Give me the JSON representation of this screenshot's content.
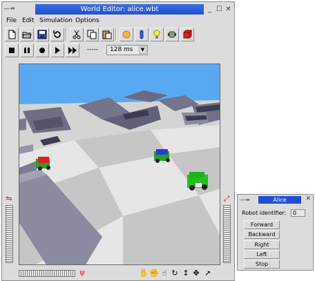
{
  "main_window": {
    "title": "World Editor: alice.wbt",
    "controls": {
      "left": "—⇸",
      "minimize": "_",
      "maximize": "☐",
      "close": "✕"
    },
    "menu": [
      "File",
      "Edit",
      "Simulation",
      "Options"
    ]
  },
  "simulation": {
    "time_readout": "-----",
    "speed_value": "128 ms"
  },
  "toolbar_icons": {
    "row1": [
      "new-file-icon",
      "open-file-icon",
      "save-icon",
      "revert-icon",
      "cut-icon",
      "copy-icon",
      "paste-icon",
      "light-bulb-orange-icon",
      "cylinder-icon",
      "light-icon",
      "robot-icon",
      "box-icon"
    ],
    "row2": [
      "stop-icon",
      "pause-icon",
      "record-icon",
      "play-icon",
      "fast-forward-icon"
    ]
  },
  "alice_window": {
    "title": "Alice",
    "controls": {
      "left": "—⇸",
      "close": "✕"
    },
    "robot_identifier_label": "Robot identifier:",
    "robot_identifier_value": "0",
    "buttons": {
      "forward": "Forward",
      "backward": "Backward",
      "right": "Right",
      "left": "Left",
      "stop": "Stop"
    }
  },
  "colors": {
    "title_active": "#1f4fd6",
    "sky": "#59a9f2",
    "floor_light": "#e0e0e0",
    "floor_dark": "#c7c7c7",
    "wall": "#7c7c90",
    "robot_red": "#e02020",
    "robot_blue": "#2040d8",
    "robot_green": "#20c020"
  }
}
